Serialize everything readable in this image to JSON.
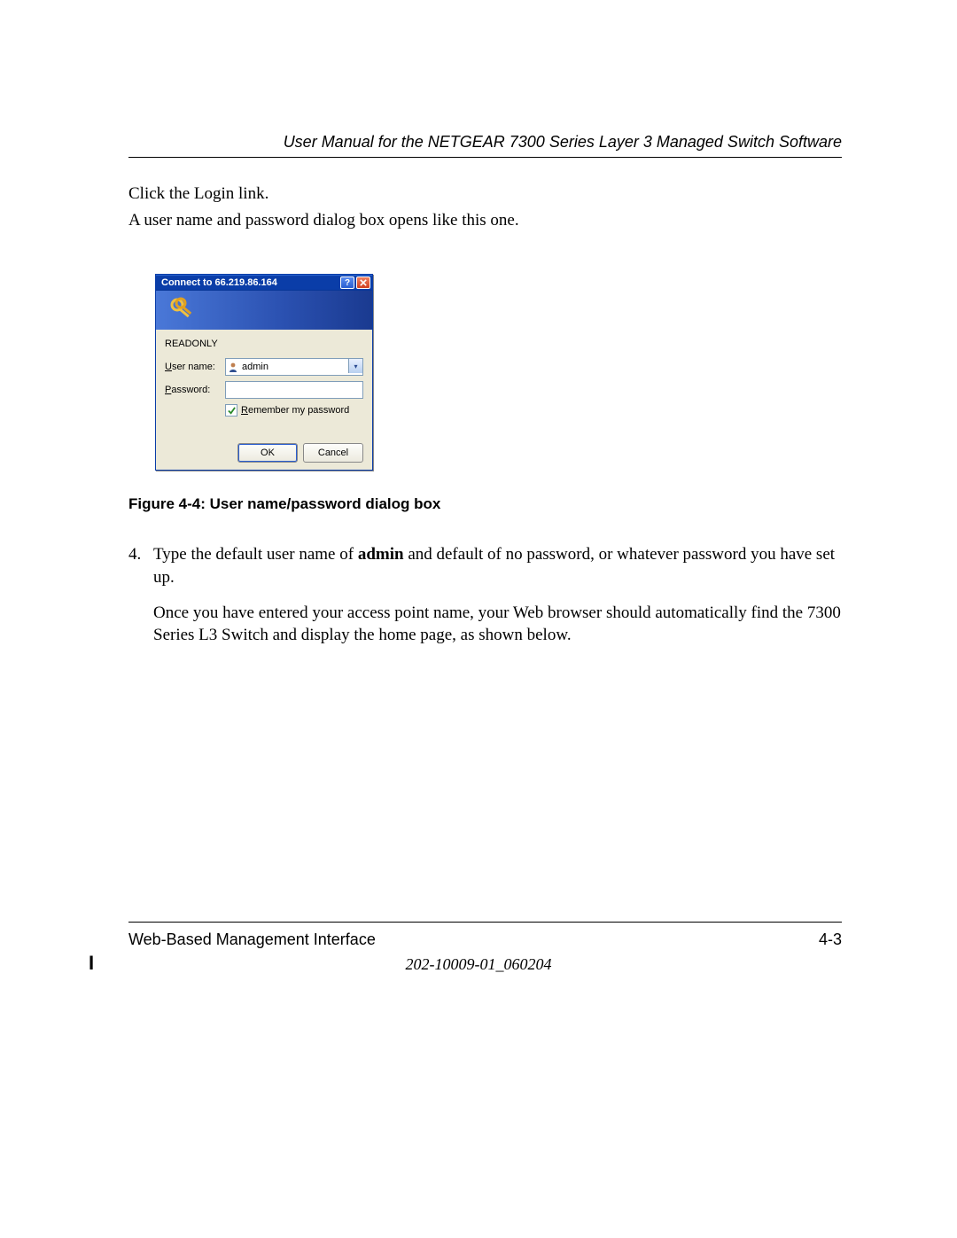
{
  "header": {
    "title": "User Manual for the NETGEAR 7300 Series Layer 3 Managed Switch Software"
  },
  "intro": {
    "line1": "Click the Login link.",
    "line2": "A user name and password dialog box opens like this one."
  },
  "dialog": {
    "title": "Connect to 66.219.86.164",
    "realm": "READONLY",
    "username_label_pre": "U",
    "username_label_post": "ser name:",
    "username_value": "admin",
    "password_label_pre": "P",
    "password_label_post": "assword:",
    "remember_pre": "R",
    "remember_post": "emember my password",
    "ok": "OK",
    "cancel": "Cancel"
  },
  "figure_caption": "Figure 4-4: User name/password dialog box",
  "step4": {
    "num": "4.",
    "p1_a": "Type the default user name of ",
    "p1_bold": "admin",
    "p1_b": " and default of no password, or whatever password you have set up.",
    "p2": "Once you have entered your access point name, your Web browser should automatically find the 7300 Series L3 Switch and display the home page, as shown below."
  },
  "footer": {
    "left": "Web-Based Management Interface",
    "right": "4-3",
    "docnum": "202-10009-01_060204"
  }
}
